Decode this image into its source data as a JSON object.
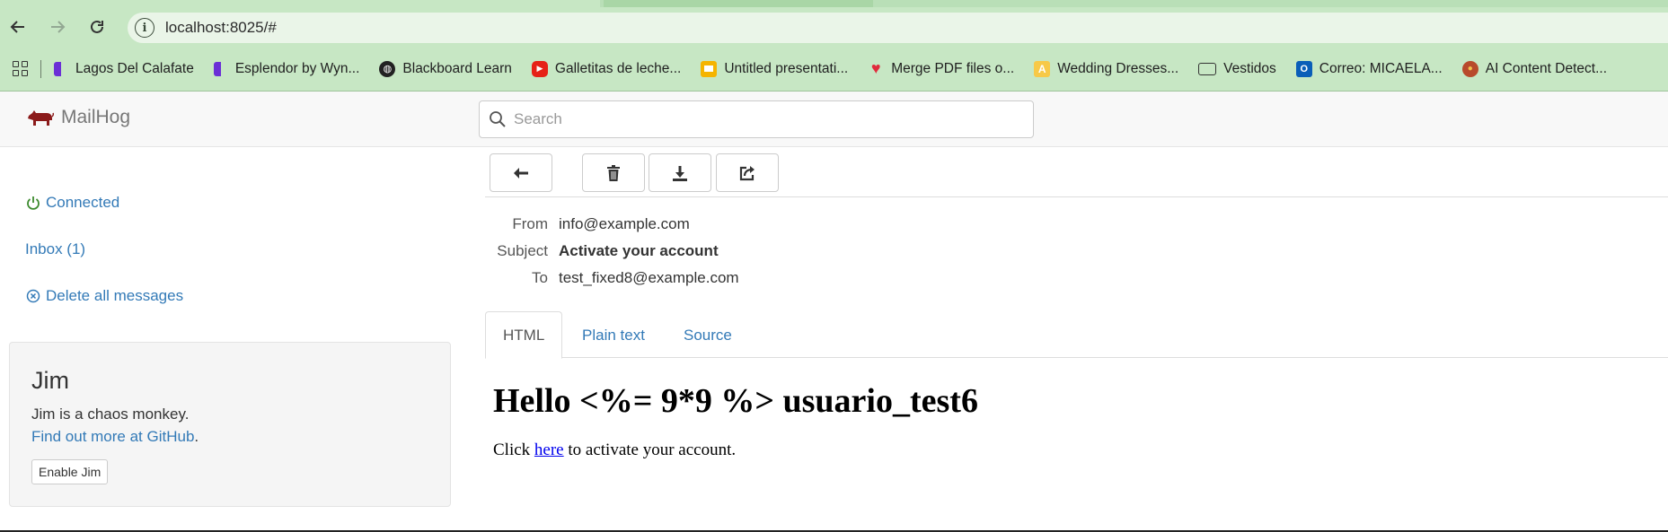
{
  "browser": {
    "url": "localhost:8025/#",
    "bookmarks": [
      {
        "label": "Lagos Del Calafate",
        "icon": "half-circle-icon"
      },
      {
        "label": "Esplendor by Wyn...",
        "icon": "half-circle-icon"
      },
      {
        "label": "Blackboard Learn",
        "icon": "globe-icon"
      },
      {
        "label": "Galletitas de leche...",
        "icon": "youtube-icon"
      },
      {
        "label": "Untitled presentati...",
        "icon": "slides-icon"
      },
      {
        "label": "Merge PDF files o...",
        "icon": "heart-icon"
      },
      {
        "label": "Wedding Dresses...",
        "icon": "w-icon"
      },
      {
        "label": "Vestidos",
        "icon": "folder-icon"
      },
      {
        "label": "Correo: MICAELA...",
        "icon": "outlook-icon"
      },
      {
        "label": "AI Content Detect...",
        "icon": "ai-icon"
      }
    ]
  },
  "app": {
    "name": "MailHog",
    "search_placeholder": "Search"
  },
  "sidebar": {
    "connected": "Connected",
    "inbox": "Inbox (1)",
    "delete_all": "Delete all messages"
  },
  "jim": {
    "title": "Jim",
    "description": "Jim is a chaos monkey.",
    "link": "Find out more at GitHub",
    "link_suffix": ".",
    "button": "Enable Jim"
  },
  "message": {
    "toolbar": [
      "back-arrow-icon",
      "trash-icon",
      "download-icon",
      "share-icon"
    ],
    "from_label": "From",
    "from": "info@example.com",
    "subject_label": "Subject",
    "subject": "Activate your account",
    "to_label": "To",
    "to": "test_fixed8@example.com",
    "tabs": [
      "HTML",
      "Plain text",
      "Source"
    ],
    "active_tab": "HTML",
    "body_heading": "Hello <%= 9*9 %> usuario_test6",
    "body_pre": "Click ",
    "body_link": "here",
    "body_post": " to activate your account."
  }
}
